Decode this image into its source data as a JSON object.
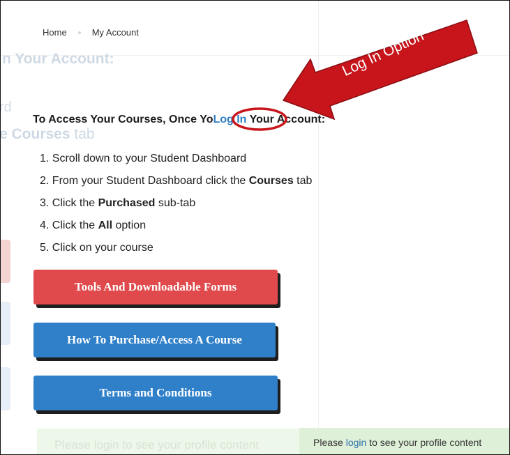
{
  "breadcrumb": {
    "home": "Home",
    "current": "My Account"
  },
  "background_ghost": {
    "title": "n Your Account:",
    "fragment_rd": "rd",
    "courses_bold": "e Courses",
    "courses_light": " tab"
  },
  "heading": {
    "prefix": "To Access Your Courses, Once Yo",
    "link": "Log In",
    "suffix": " Your Account:"
  },
  "steps": [
    {
      "num": "1.",
      "pre": " Scroll down to your Student Dashboard",
      "bold": "",
      "post": ""
    },
    {
      "num": "2.",
      "pre": " From your Student Dashboard click the ",
      "bold": "Courses",
      "post": " tab"
    },
    {
      "num": "3.",
      "pre": " Click the ",
      "bold": "Purchased",
      "post": " sub-tab"
    },
    {
      "num": "4.",
      "pre": " Click the ",
      "bold": "All",
      "post": " option"
    },
    {
      "num": "5.",
      "pre": " Click on your course",
      "bold": "",
      "post": ""
    }
  ],
  "buttons": {
    "tools": "Tools And Downloadable Forms",
    "purchase": "How To Purchase/Access A Course",
    "terms": "Terms and Conditions"
  },
  "notice": {
    "ghost_text": "Please login to see your profile content",
    "pre": "Please ",
    "link": "login",
    "post": " to see your profile content"
  },
  "annotation": {
    "label": "Log In Option"
  },
  "colors": {
    "red_button": "#e04a4c",
    "blue_button": "#2f80c9",
    "annotation_red": "#c8151b",
    "link_blue": "#2f7fc2",
    "notice_green": "#dff0d8"
  }
}
